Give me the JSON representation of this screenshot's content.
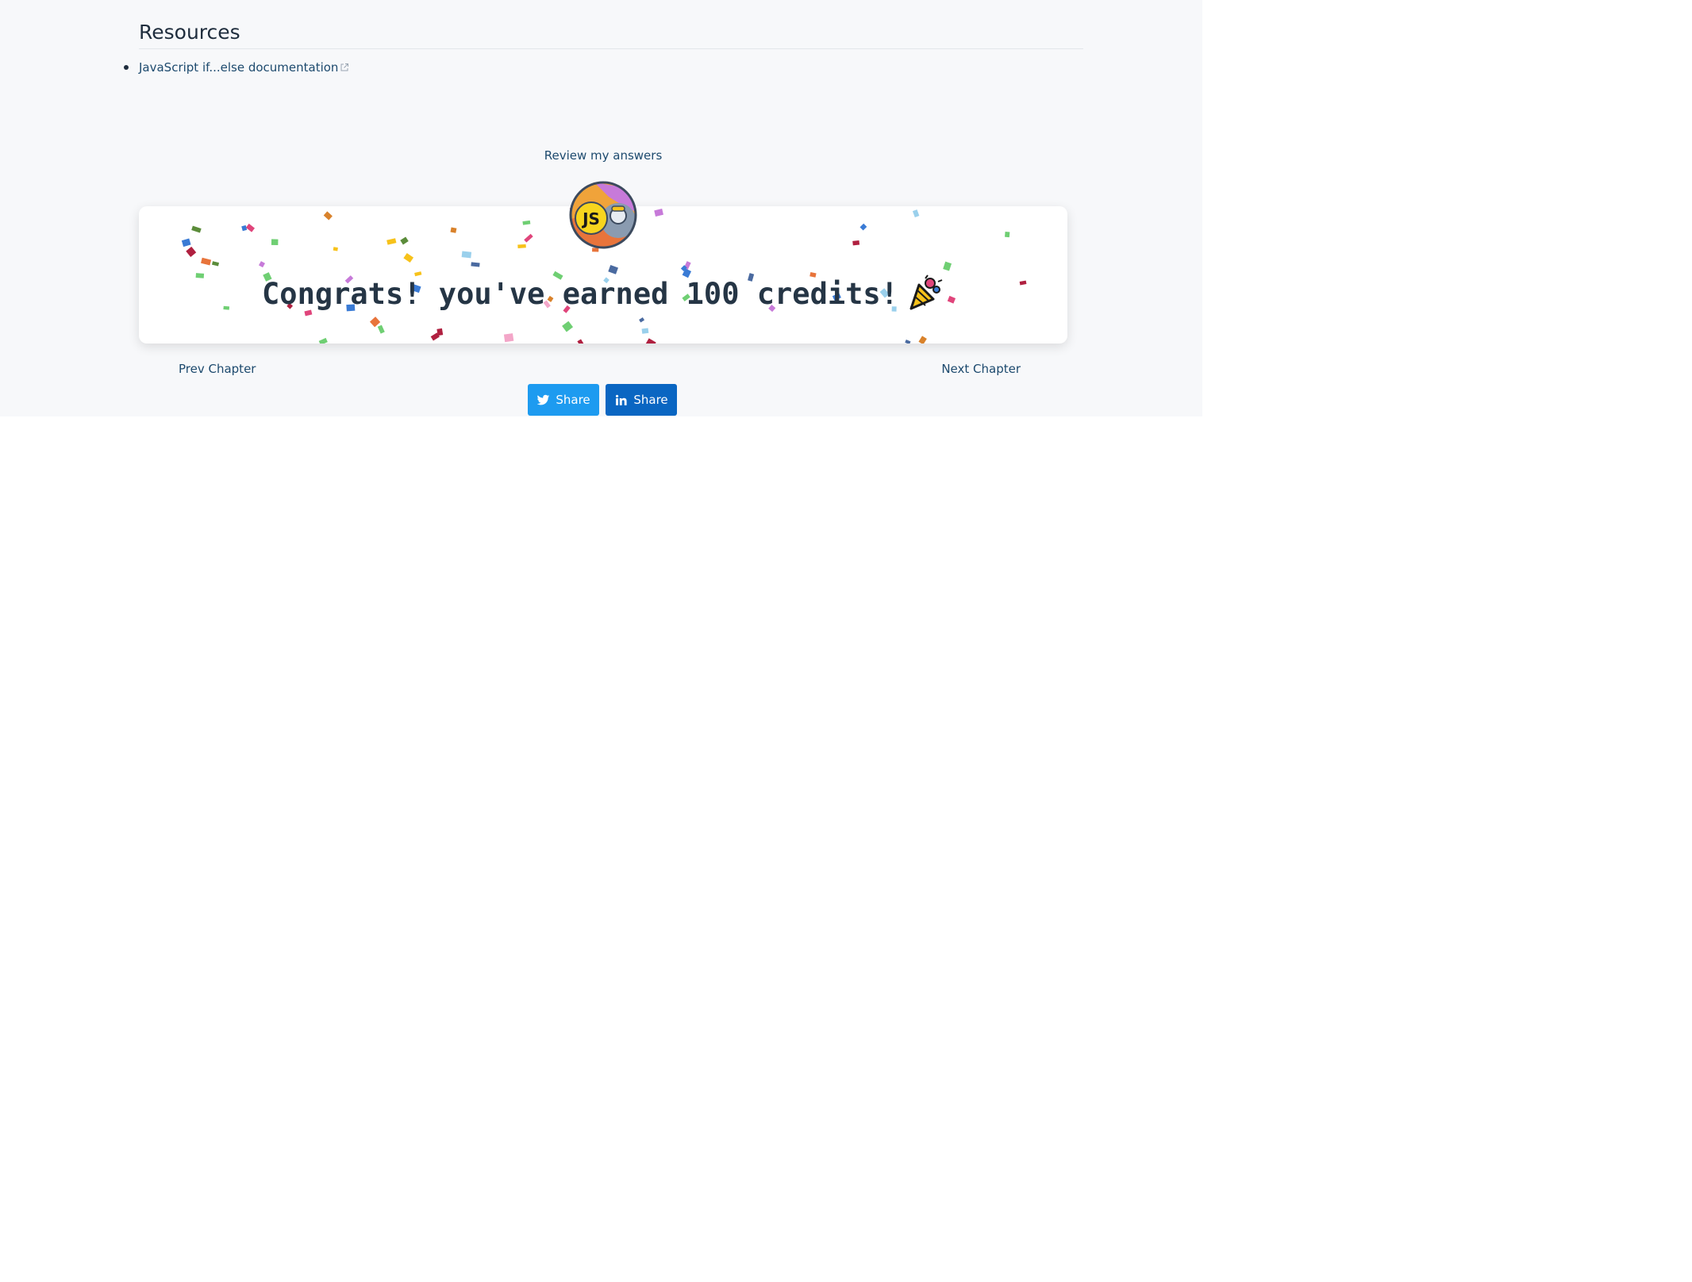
{
  "resources": {
    "heading": "Resources",
    "items": [
      {
        "label": "JavaScript if...else documentation",
        "external": true
      }
    ]
  },
  "review": {
    "label": "Review my answers"
  },
  "congrats": {
    "message": "Congrats! you've earned 100 credits!",
    "badge_icon": "javascript-badge-icon",
    "badge_text": "JS",
    "celebration_icon": "party-popper-icon"
  },
  "navigation": {
    "prev_label": "Prev Chapter",
    "next_label": "Next Chapter"
  },
  "share": {
    "twitter_label": "Share",
    "linkedin_label": "Share"
  },
  "colors": {
    "page_background": "#f7f8fa",
    "link": "#1d4a6e",
    "twitter": "#1d9bf0",
    "linkedin": "#0a66c2",
    "badge_yellow": "#f7c21a"
  }
}
